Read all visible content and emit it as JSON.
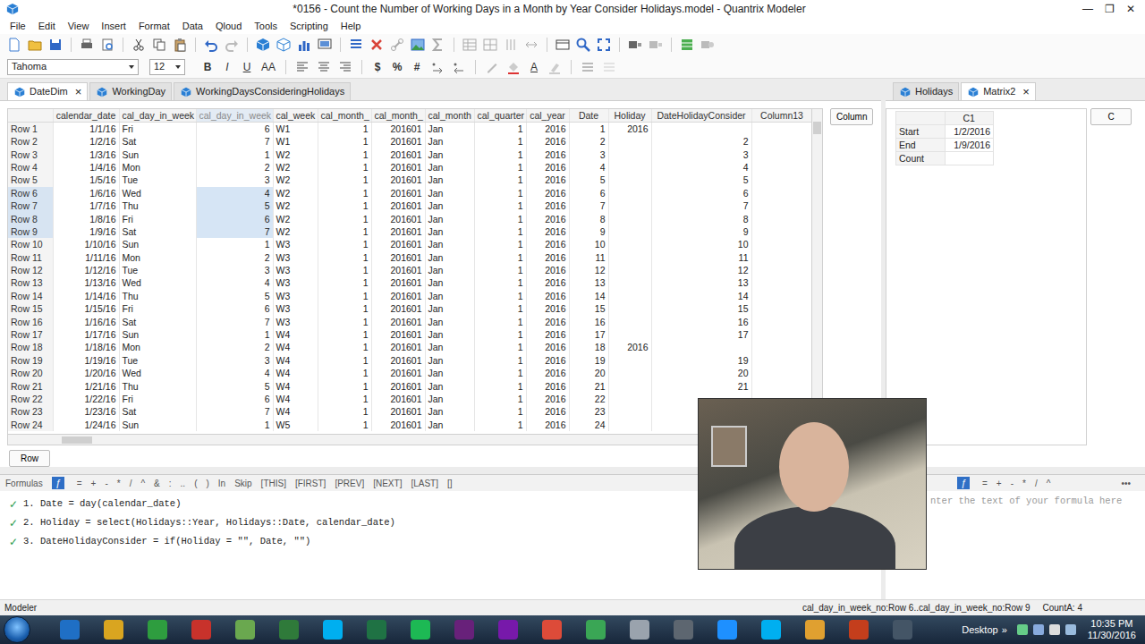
{
  "window": {
    "title": "*0156 - Count the Number of Working Days in a Month by Year Consider Holidays.model - Quantrix Modeler",
    "controls": [
      "—",
      "❐",
      "✕"
    ]
  },
  "menu": [
    "File",
    "Edit",
    "View",
    "Insert",
    "Format",
    "Data",
    "Qloud",
    "Tools",
    "Scripting",
    "Help"
  ],
  "format_bar": {
    "font": "Tahoma",
    "size": "12",
    "style_buttons": [
      "B",
      "I",
      "U",
      "AA"
    ],
    "number_buttons": [
      "$",
      "%",
      "#"
    ],
    "color_button": "A"
  },
  "left_tabs": [
    {
      "label": "DateDim",
      "selected": true,
      "close": "×"
    },
    {
      "label": "WorkingDay",
      "selected": false
    },
    {
      "label": "WorkingDaysConsideringHolidays",
      "selected": false
    }
  ],
  "right_tabs": [
    {
      "label": "Holidays",
      "selected": false
    },
    {
      "label": "Matrix2",
      "selected": true,
      "close": "×"
    }
  ],
  "grid": {
    "column_button": "Column",
    "row_button": "Row",
    "columns": [
      {
        "label": "calendar_date",
        "selected": false
      },
      {
        "label": "cal_day_in_week",
        "selected": false
      },
      {
        "label": "cal_day_in_week",
        "selected": true
      },
      {
        "label": "cal_week",
        "selected": false
      },
      {
        "label": "cal_month_",
        "selected": false
      },
      {
        "label": "cal_month_",
        "selected": false
      },
      {
        "label": "cal_month",
        "selected": false
      },
      {
        "label": "cal_quarter",
        "selected": false
      },
      {
        "label": "cal_year",
        "selected": false
      },
      {
        "label": "Date",
        "selected": false
      },
      {
        "label": "Holiday",
        "selected": false
      },
      {
        "label": "DateHolidayConsider",
        "selected": false
      },
      {
        "label": "Column13",
        "selected": false
      }
    ],
    "rows": [
      {
        "header": "Row 1",
        "selected": false,
        "cells": [
          "1/1/16",
          "Fri",
          "6",
          "W1",
          "1",
          "201601",
          "Jan",
          "1",
          "2016",
          "1",
          "2016",
          "",
          ""
        ]
      },
      {
        "header": "Row 2",
        "selected": false,
        "cells": [
          "1/2/16",
          "Sat",
          "7",
          "W1",
          "1",
          "201601",
          "Jan",
          "1",
          "2016",
          "2",
          "",
          "2",
          ""
        ]
      },
      {
        "header": "Row 3",
        "selected": false,
        "cells": [
          "1/3/16",
          "Sun",
          "1",
          "W2",
          "1",
          "201601",
          "Jan",
          "1",
          "2016",
          "3",
          "",
          "3",
          ""
        ]
      },
      {
        "header": "Row 4",
        "selected": false,
        "cells": [
          "1/4/16",
          "Mon",
          "2",
          "W2",
          "1",
          "201601",
          "Jan",
          "1",
          "2016",
          "4",
          "",
          "4",
          ""
        ]
      },
      {
        "header": "Row 5",
        "selected": false,
        "cells": [
          "1/5/16",
          "Tue",
          "3",
          "W2",
          "1",
          "201601",
          "Jan",
          "1",
          "2016",
          "5",
          "",
          "5",
          ""
        ]
      },
      {
        "header": "Row 6",
        "selected": true,
        "cells": [
          "1/6/16",
          "Wed",
          "4",
          "W2",
          "1",
          "201601",
          "Jan",
          "1",
          "2016",
          "6",
          "",
          "6",
          ""
        ]
      },
      {
        "header": "Row 7",
        "selected": true,
        "cells": [
          "1/7/16",
          "Thu",
          "5",
          "W2",
          "1",
          "201601",
          "Jan",
          "1",
          "2016",
          "7",
          "",
          "7",
          ""
        ]
      },
      {
        "header": "Row 8",
        "selected": true,
        "cells": [
          "1/8/16",
          "Fri",
          "6",
          "W2",
          "1",
          "201601",
          "Jan",
          "1",
          "2016",
          "8",
          "",
          "8",
          ""
        ]
      },
      {
        "header": "Row 9",
        "selected": true,
        "cells": [
          "1/9/16",
          "Sat",
          "7",
          "W2",
          "1",
          "201601",
          "Jan",
          "1",
          "2016",
          "9",
          "",
          "9",
          ""
        ]
      },
      {
        "header": "Row 10",
        "selected": false,
        "cells": [
          "1/10/16",
          "Sun",
          "1",
          "W3",
          "1",
          "201601",
          "Jan",
          "1",
          "2016",
          "10",
          "",
          "10",
          ""
        ]
      },
      {
        "header": "Row 11",
        "selected": false,
        "cells": [
          "1/11/16",
          "Mon",
          "2",
          "W3",
          "1",
          "201601",
          "Jan",
          "1",
          "2016",
          "11",
          "",
          "11",
          ""
        ]
      },
      {
        "header": "Row 12",
        "selected": false,
        "cells": [
          "1/12/16",
          "Tue",
          "3",
          "W3",
          "1",
          "201601",
          "Jan",
          "1",
          "2016",
          "12",
          "",
          "12",
          ""
        ]
      },
      {
        "header": "Row 13",
        "selected": false,
        "cells": [
          "1/13/16",
          "Wed",
          "4",
          "W3",
          "1",
          "201601",
          "Jan",
          "1",
          "2016",
          "13",
          "",
          "13",
          ""
        ]
      },
      {
        "header": "Row 14",
        "selected": false,
        "cells": [
          "1/14/16",
          "Thu",
          "5",
          "W3",
          "1",
          "201601",
          "Jan",
          "1",
          "2016",
          "14",
          "",
          "14",
          ""
        ]
      },
      {
        "header": "Row 15",
        "selected": false,
        "cells": [
          "1/15/16",
          "Fri",
          "6",
          "W3",
          "1",
          "201601",
          "Jan",
          "1",
          "2016",
          "15",
          "",
          "15",
          ""
        ]
      },
      {
        "header": "Row 16",
        "selected": false,
        "cells": [
          "1/16/16",
          "Sat",
          "7",
          "W3",
          "1",
          "201601",
          "Jan",
          "1",
          "2016",
          "16",
          "",
          "16",
          ""
        ]
      },
      {
        "header": "Row 17",
        "selected": false,
        "cells": [
          "1/17/16",
          "Sun",
          "1",
          "W4",
          "1",
          "201601",
          "Jan",
          "1",
          "2016",
          "17",
          "",
          "17",
          ""
        ]
      },
      {
        "header": "Row 18",
        "selected": false,
        "cells": [
          "1/18/16",
          "Mon",
          "2",
          "W4",
          "1",
          "201601",
          "Jan",
          "1",
          "2016",
          "18",
          "2016",
          "",
          ""
        ]
      },
      {
        "header": "Row 19",
        "selected": false,
        "cells": [
          "1/19/16",
          "Tue",
          "3",
          "W4",
          "1",
          "201601",
          "Jan",
          "1",
          "2016",
          "19",
          "",
          "19",
          ""
        ]
      },
      {
        "header": "Row 20",
        "selected": false,
        "cells": [
          "1/20/16",
          "Wed",
          "4",
          "W4",
          "1",
          "201601",
          "Jan",
          "1",
          "2016",
          "20",
          "",
          "20",
          ""
        ]
      },
      {
        "header": "Row 21",
        "selected": false,
        "cells": [
          "1/21/16",
          "Thu",
          "5",
          "W4",
          "1",
          "201601",
          "Jan",
          "1",
          "2016",
          "21",
          "",
          "21",
          ""
        ]
      },
      {
        "header": "Row 22",
        "selected": false,
        "cells": [
          "1/22/16",
          "Fri",
          "6",
          "W4",
          "1",
          "201601",
          "Jan",
          "1",
          "2016",
          "22",
          "",
          "",
          ""
        ]
      },
      {
        "header": "Row 23",
        "selected": false,
        "cells": [
          "1/23/16",
          "Sat",
          "7",
          "W4",
          "1",
          "201601",
          "Jan",
          "1",
          "2016",
          "23",
          "",
          "",
          ""
        ]
      },
      {
        "header": "Row 24",
        "selected": false,
        "cells": [
          "1/24/16",
          "Sun",
          "1",
          "W5",
          "1",
          "201601",
          "Jan",
          "1",
          "2016",
          "24",
          "",
          "",
          ""
        ]
      }
    ]
  },
  "formulas": {
    "title": "Formulas",
    "fx": "ƒ",
    "toolbar": [
      "=",
      "+",
      "-",
      "*",
      "/",
      "^",
      "&",
      ":",
      "..",
      "(",
      ")",
      "In",
      "Skip",
      "[THIS]",
      "[FIRST]",
      "[PREV]",
      "[NEXT]",
      "[LAST]",
      "[]"
    ],
    "items": [
      {
        "check": "✓",
        "text": "1. Date = day(calendar_date)"
      },
      {
        "check": "✓",
        "text": "2. Holiday = select(Holidays::Year, Holidays::Date, calendar_date)"
      },
      {
        "check": "✓",
        "text": "3. DateHolidayConsider = if(Holiday = \"\", Date, \"\")"
      }
    ]
  },
  "matrix": {
    "columns": [
      "C1"
    ],
    "rows": [
      {
        "label": "Start",
        "cells": [
          "1/2/2016"
        ]
      },
      {
        "label": "End",
        "cells": [
          "1/9/2016"
        ]
      },
      {
        "label": "Count",
        "cells": [
          ""
        ]
      }
    ],
    "column_button": "C",
    "fx": "ƒ",
    "toolbar": [
      "=",
      "+",
      "-",
      "*",
      "/",
      "^"
    ],
    "more": "•••",
    "placeholder": "nter the text of your formula here"
  },
  "status_bar": {
    "left": "Modeler",
    "selection": "cal_day_in_week_no:Row 6..cal_day_in_week_no:Row 9",
    "count": "CountA: 4"
  },
  "taskbar": {
    "desktop": "Desktop",
    "overflow": "»",
    "time": "10:35 PM",
    "date": "11/30/2016"
  }
}
